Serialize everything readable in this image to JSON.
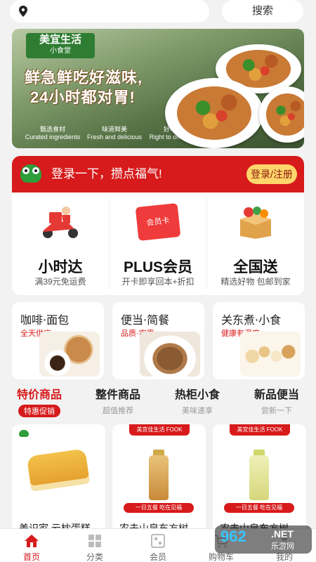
{
  "header": {
    "search_label": "搜索"
  },
  "banner": {
    "brand_name": "美宜生活",
    "brand_sub": "小食堂",
    "slogan_line1": "鲜急鲜吃好滋味,",
    "slogan_line2": "24小时都对胃!",
    "badges": [
      {
        "cn": "甄选食材",
        "en": "Curated ingredients"
      },
      {
        "cn": "味道鲜美",
        "en": "Fresh and delicious"
      },
      {
        "cn": "好吃对胃",
        "en": "Right to one's taste"
      }
    ]
  },
  "login": {
    "prompt": "登录一下，攒点福气!",
    "button": "登录/注册"
  },
  "services": [
    {
      "title": "小时达",
      "subtitle": "满39元免运费",
      "icon": "scooter-courier-icon"
    },
    {
      "title": "PLUS会员",
      "subtitle": "开卡即享回本+折扣",
      "icon": "member-card-icon",
      "card_text": "会员卡"
    },
    {
      "title": "全国送",
      "subtitle": "精选好物 包邮到家",
      "icon": "delivery-box-icon"
    }
  ],
  "categories": [
    {
      "title": "咖啡·面包",
      "subtitle": "全天供应 >"
    },
    {
      "title": "便当·简餐",
      "subtitle": "品质·实惠 >"
    },
    {
      "title": "关东煮·小食",
      "subtitle": "健康有温度 >"
    }
  ],
  "tabs": [
    {
      "title": "特价商品",
      "subtitle": "特惠促销",
      "active": true
    },
    {
      "title": "整件商品",
      "subtitle": "超值推荐",
      "active": false
    },
    {
      "title": "热柜小食",
      "subtitle": "美味速享",
      "active": false
    },
    {
      "title": "新品便当",
      "subtitle": "尝新一下",
      "active": false
    }
  ],
  "products": [
    {
      "name": "美识家 云枕蛋糕"
    },
    {
      "name": "农夫山泉东方树",
      "ribbon": "美宜佳生活 FOOK",
      "promo": "一日五餐 吃在见福"
    },
    {
      "name": "农夫山泉东方树",
      "ribbon": "美宜佳生活 FOOK",
      "promo": "一日五餐 吃在见福"
    }
  ],
  "bottom_nav": [
    {
      "label": "首页",
      "icon": "home-icon",
      "active": true
    },
    {
      "label": "分类",
      "icon": "grid-icon",
      "active": false
    },
    {
      "label": "会员",
      "icon": "member-code-icon",
      "active": false
    },
    {
      "label": "购物车",
      "icon": "cart-icon",
      "active": false
    },
    {
      "label": "我的",
      "icon": "user-icon",
      "active": false
    }
  ],
  "watermark": {
    "site": "962",
    "tld": ".NET",
    "name": "乐游网"
  },
  "colors": {
    "accent": "#d71a1b",
    "login_button": "#ffd66b",
    "brand_green": "#2f7d32"
  }
}
